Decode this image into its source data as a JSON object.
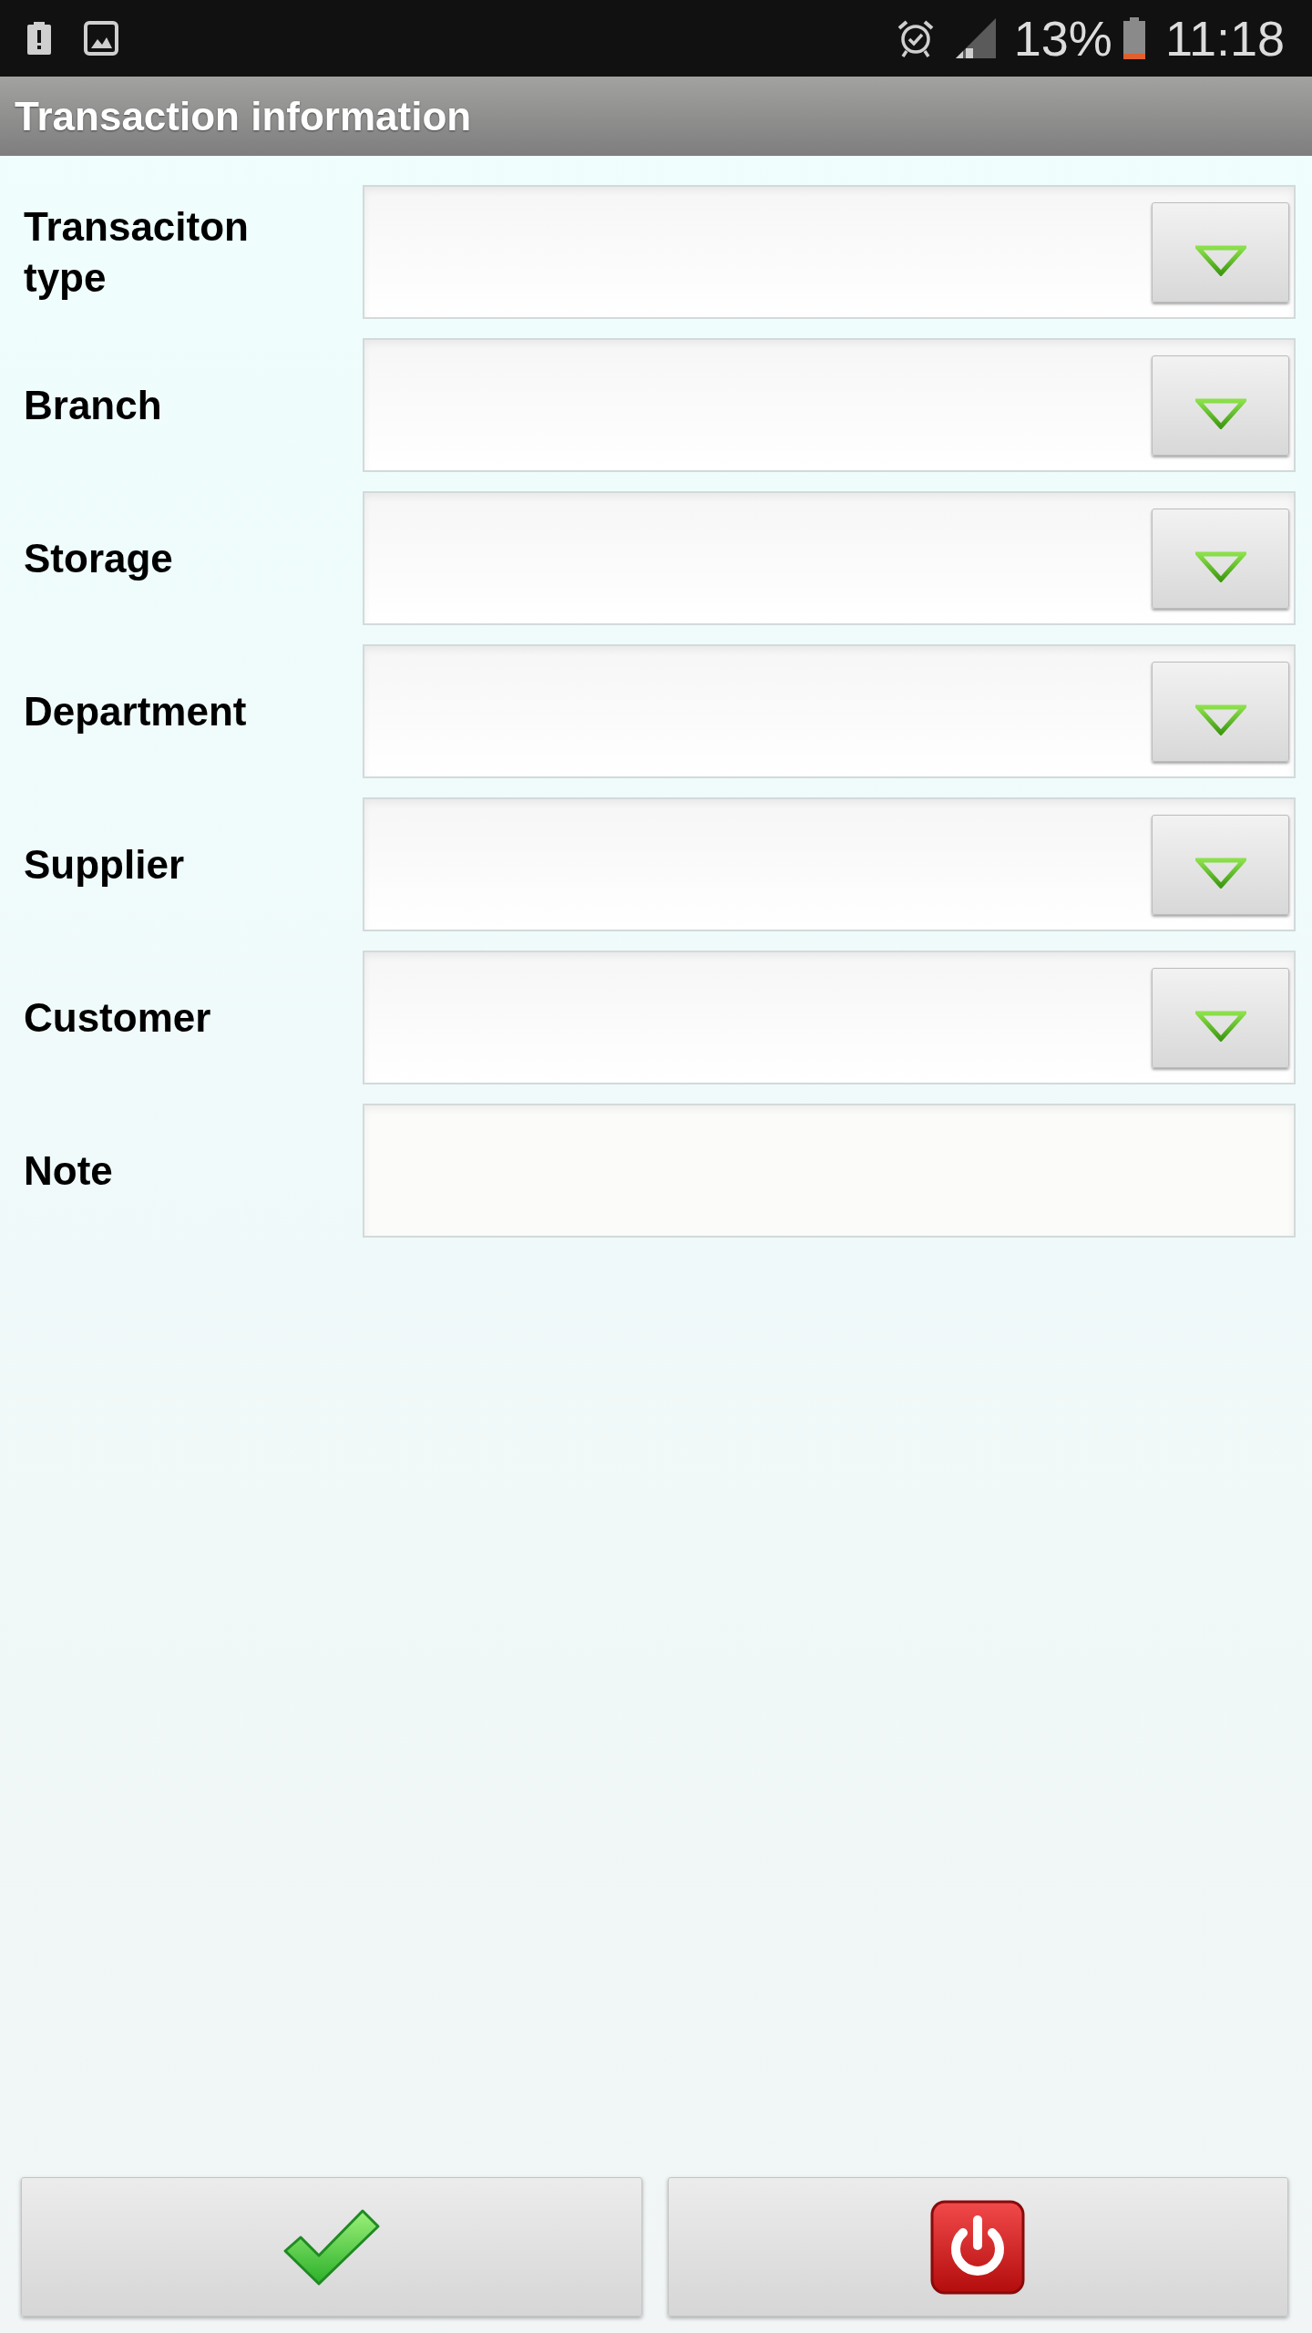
{
  "status_bar": {
    "battery_percent": "13%",
    "time": "11:18"
  },
  "title": "Transaction information",
  "fields": [
    {
      "label": "Transaciton type",
      "kind": "dropdown"
    },
    {
      "label": "Branch",
      "kind": "dropdown"
    },
    {
      "label": "Storage",
      "kind": "dropdown"
    },
    {
      "label": "Department",
      "kind": "dropdown"
    },
    {
      "label": "Supplier",
      "kind": "dropdown"
    },
    {
      "label": "Customer",
      "kind": "dropdown"
    },
    {
      "label": "Note",
      "kind": "text"
    }
  ],
  "buttons": [
    {
      "kind": "confirm"
    },
    {
      "kind": "power"
    }
  ]
}
